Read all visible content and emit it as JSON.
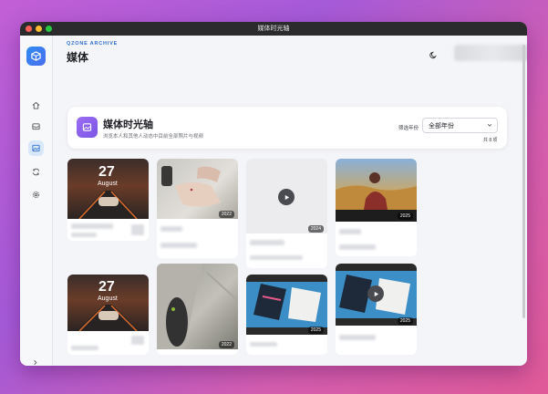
{
  "window": {
    "title": "媒体时光轴"
  },
  "header": {
    "brand": "QZONE ARCHIVE",
    "title": "媒体"
  },
  "card": {
    "title": "媒体时光轴",
    "subtitle": "浏览本人和其他人动态中目前全部照片与视频",
    "filter_label": "筛选年份",
    "filter_value": "全部年份",
    "count": "共 8 项"
  },
  "tiles": [
    {
      "date_num": "27",
      "date_month": "August",
      "badge": ""
    },
    {
      "badge": "2022"
    },
    {
      "badge": "2024"
    },
    {
      "badge": "2025"
    },
    {
      "date_num": "27",
      "date_month": "August",
      "badge": ""
    },
    {
      "badge": "2022"
    },
    {
      "badge": "2025"
    },
    {
      "badge": "2025"
    }
  ],
  "colors": {
    "accent": "#2f8df0",
    "card_icon": "#8b5df0",
    "sidebar_active": "#d9e7fb"
  },
  "icons": [
    "home-icon",
    "inbox-icon",
    "media-icon",
    "sync-icon",
    "settings-icon",
    "chevron-right-icon",
    "moon-icon",
    "play-icon",
    "chevron-down-icon"
  ]
}
